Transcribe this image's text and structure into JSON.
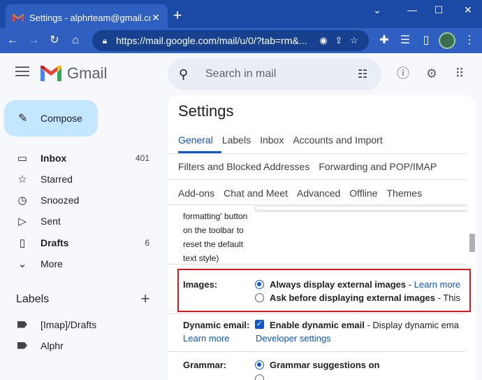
{
  "browser": {
    "tab_title": "Settings - alphrteam@gmail.com",
    "tab_close": "✕",
    "new_tab": "+",
    "url": "https://mail.google.com/mail/u/0/?tab=rm&...",
    "window_controls": {
      "minimize": "⌄",
      "restore": "—",
      "maximize": "☐",
      "close": "✕"
    }
  },
  "header": {
    "app_name": "Gmail",
    "search_placeholder": "Search in mail"
  },
  "sidebar": {
    "compose_label": "Compose",
    "items": [
      {
        "label": "Inbox",
        "count": "401",
        "icon": "inbox-icon",
        "glyph": "▭",
        "bold": true
      },
      {
        "label": "Starred",
        "count": "",
        "icon": "star-icon",
        "glyph": "☆",
        "bold": false
      },
      {
        "label": "Snoozed",
        "count": "",
        "icon": "clock-icon",
        "glyph": "◷",
        "bold": false
      },
      {
        "label": "Sent",
        "count": "",
        "icon": "send-icon",
        "glyph": "▷",
        "bold": false
      },
      {
        "label": "Drafts",
        "count": "6",
        "icon": "draft-icon",
        "glyph": "▯",
        "bold": true
      },
      {
        "label": "More",
        "count": "",
        "icon": "chevron-down-icon",
        "glyph": "⌄",
        "bold": false
      }
    ],
    "labels_title": "Labels",
    "labels_add": "+",
    "labels": [
      "[Imap]/Drafts",
      "Alphr"
    ]
  },
  "settings": {
    "title": "Settings",
    "tabs_row1": [
      "General",
      "Labels",
      "Inbox",
      "Accounts and Import"
    ],
    "tabs_row2": [
      "Filters and Blocked Addresses",
      "Forwarding and POP/IMAP"
    ],
    "tabs_row3": [
      "Add-ons",
      "Chat and Meet",
      "Advanced",
      "Offline",
      "Themes"
    ],
    "formatting_text": "formatting' button on the toolbar to reset the default text style)",
    "images": {
      "label": "Images:",
      "opt1_bold": "Always display external images",
      "opt1_sep": " - ",
      "opt1_link": "Learn more",
      "opt2_bold": "Ask before displaying external images",
      "opt2_rest": " - This"
    },
    "dynamic_email": {
      "label": "Dynamic email:",
      "learn_more": "Learn more",
      "check_bold": "Enable dynamic email",
      "check_rest": " - Display dynamic ema",
      "developer_settings": "Developer settings"
    },
    "grammar": {
      "label": "Grammar:",
      "opt1_bold": "Grammar suggestions on"
    }
  },
  "colors": {
    "accent": "#0b57d0",
    "highlight_box": "#e0161f",
    "compose_bg": "#c2e7ff"
  }
}
